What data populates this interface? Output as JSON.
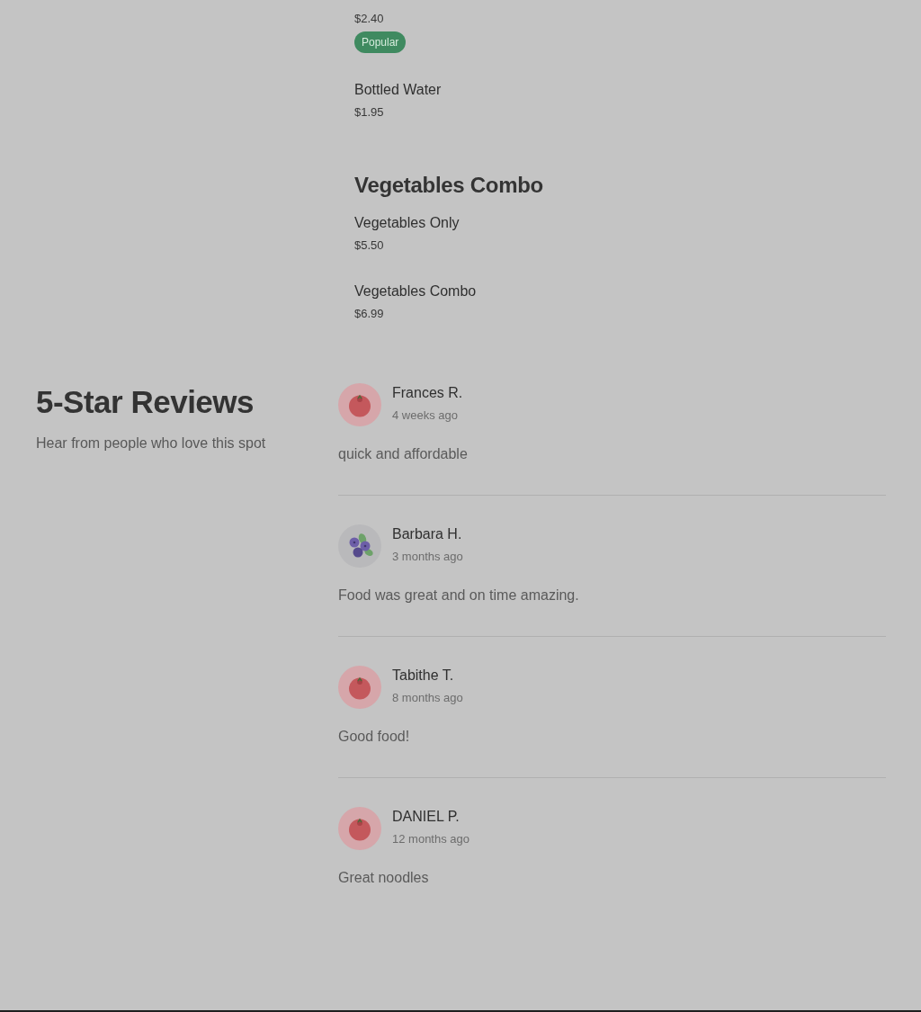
{
  "menu_sections": [
    {
      "items": [
        {
          "price": "$2.40",
          "badge": "Popular"
        },
        {
          "name": "Bottled Water",
          "price": "$1.95"
        }
      ]
    },
    {
      "title": "Vegetables Combo",
      "items": [
        {
          "name": "Vegetables Only",
          "price": "$5.50"
        },
        {
          "name": "Vegetables Combo",
          "price": "$6.99"
        }
      ]
    }
  ],
  "reviews": {
    "title": "5-Star Reviews",
    "subtitle": "Hear from people who love this spot",
    "items": [
      {
        "name": "Frances R.",
        "time": "4 weeks ago",
        "text": "quick and affordable",
        "avatar": {
          "kind": "tomato"
        }
      },
      {
        "name": "Barbara H.",
        "time": "3 months ago",
        "text": "Food was great and on time amazing.",
        "avatar": {
          "kind": "blueberry"
        }
      },
      {
        "name": "Tabithe T.",
        "time": "8 months ago",
        "text": "Good food!",
        "avatar": {
          "kind": "tomato"
        }
      },
      {
        "name": "DANIEL P.",
        "time": "12 months ago",
        "text": "Great noodles",
        "avatar": {
          "kind": "tomato"
        }
      }
    ]
  }
}
